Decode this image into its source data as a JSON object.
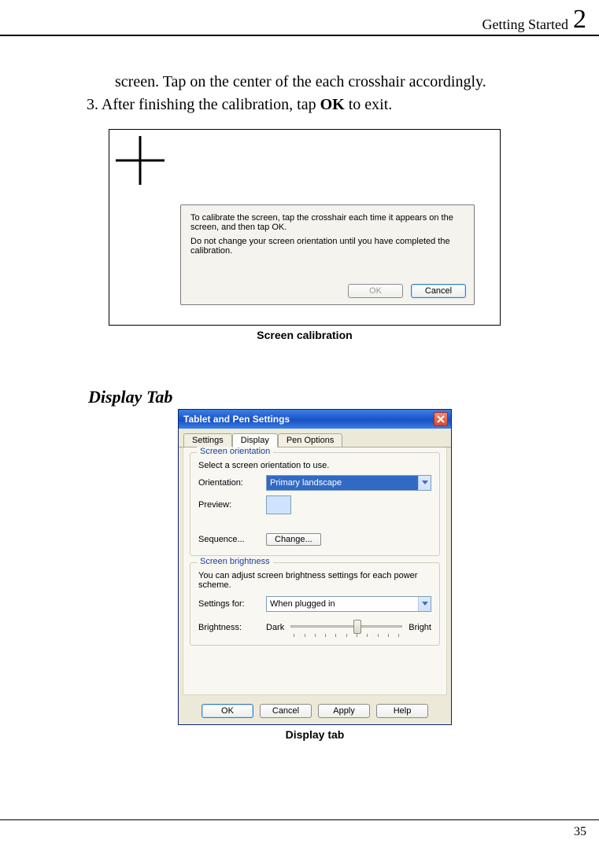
{
  "header": {
    "chapter_title": "Getting Started",
    "chapter_num": "2"
  },
  "body": {
    "line_cont": "screen. Tap on the center of the each crosshair accordingly.",
    "step3_prefix": "3. After finishing the calibration, tap ",
    "step3_bold": "OK",
    "step3_suffix": " to exit."
  },
  "fig1": {
    "dialog_line1": "To calibrate the screen, tap the crosshair each time it appears on the screen, and then tap OK.",
    "dialog_line2": "Do not change your screen orientation until you have completed the calibration.",
    "ok": "OK",
    "cancel": "Cancel",
    "caption": "Screen calibration"
  },
  "section_head": "Display Tab",
  "fig2": {
    "title": "Tablet and Pen Settings",
    "tabs": {
      "settings": "Settings",
      "display": "Display",
      "pen": "Pen Options"
    },
    "group1": {
      "title": "Screen orientation",
      "intro": "Select a screen orientation to use.",
      "orientation_label": "Orientation:",
      "orientation_value": "Primary landscape",
      "preview_label": "Preview:",
      "sequence_label": "Sequence...",
      "change_btn": "Change..."
    },
    "group2": {
      "title": "Screen brightness",
      "intro": "You can adjust screen brightness settings for each power scheme.",
      "settings_for_label": "Settings for:",
      "settings_for_value": "When plugged in",
      "brightness_label": "Brightness:",
      "dark": "Dark",
      "bright": "Bright"
    },
    "buttons": {
      "ok": "OK",
      "cancel": "Cancel",
      "apply": "Apply",
      "help": "Help"
    },
    "caption": "Display tab"
  },
  "footer": {
    "page_num": "35"
  }
}
